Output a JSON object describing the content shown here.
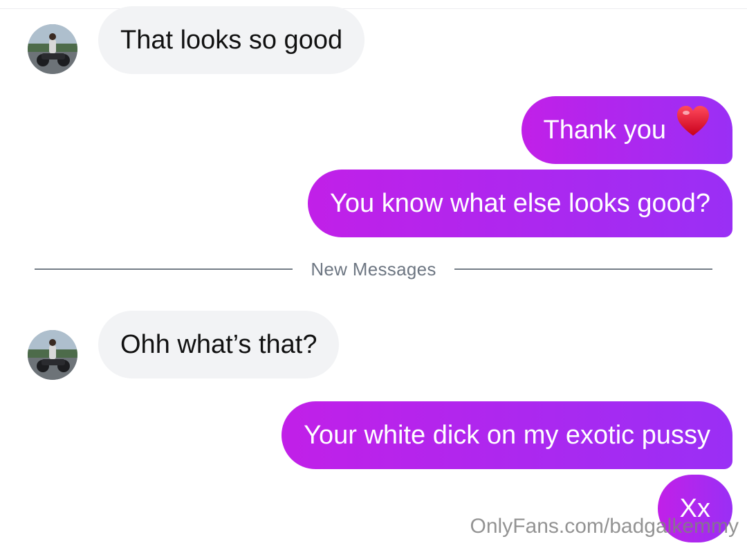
{
  "conversation": {
    "messages": [
      {
        "sender": "contact",
        "text": "That looks so good"
      },
      {
        "sender": "self",
        "text": "Thank you",
        "emoji": "red-heart"
      },
      {
        "sender": "self",
        "text": "You know what else looks good?"
      },
      {
        "sender": "contact",
        "text": "Ohh what’s that?"
      },
      {
        "sender": "self",
        "text": "Your white dick on my exotic pussy"
      },
      {
        "sender": "self",
        "text": "Xx"
      }
    ],
    "divider_label": "New Messages"
  },
  "watermark": "OnlyFans.com/badgalkemmy",
  "colors": {
    "incoming_bubble": "#f2f3f5",
    "outgoing_gradient_start": "#c120e8",
    "outgoing_gradient_end": "#9a2ff5",
    "divider_line": "#737c86",
    "heart": "#e8112d"
  }
}
